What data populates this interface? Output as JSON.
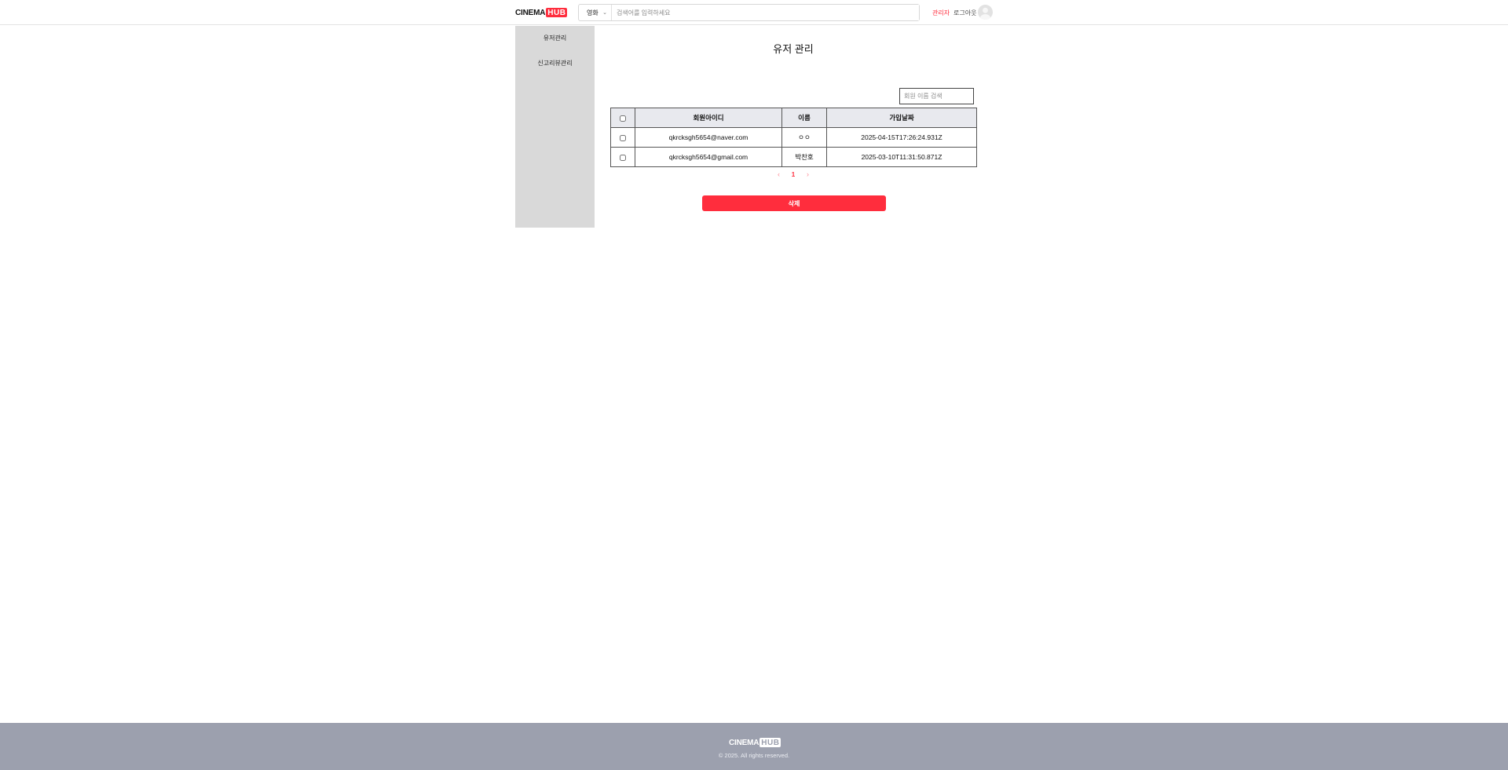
{
  "header": {
    "logo": {
      "part1": "CINEMA",
      "part2": "HUB"
    },
    "search": {
      "category": "영화",
      "placeholder": "검색어를 입력하세요"
    },
    "admin_label": "관리자",
    "logout_label": "로그아웃"
  },
  "sidebar": {
    "items": [
      {
        "label": "유저관리"
      },
      {
        "label": "신고리뷰관리"
      }
    ]
  },
  "main": {
    "title": "유저 관리",
    "name_search_placeholder": "회원 이름 검색",
    "table": {
      "headers": [
        "회원아이디",
        "이름",
        "가입날짜"
      ],
      "rows": [
        {
          "id": "qkrcksgh5654@naver.com",
          "name": "ㅇㅇ",
          "joined": "2025-04-15T17:26:24.931Z"
        },
        {
          "id": "qkrcksgh5654@gmail.com",
          "name": "박찬호",
          "joined": "2025-03-10T11:31:50.871Z"
        }
      ]
    },
    "pagination": {
      "prev": "‹",
      "current": "1",
      "next": "›"
    },
    "delete_label": "삭제"
  },
  "footer": {
    "logo": {
      "part1": "CINEMA",
      "part2": "HUB"
    },
    "copyright": "© 2025. All rights reserved."
  },
  "colors": {
    "accent": "#ff2d3d",
    "sidebar_bg": "#d9d9d9",
    "footer_bg": "#9ca0ae",
    "table_header_bg": "#e8e9ee"
  }
}
